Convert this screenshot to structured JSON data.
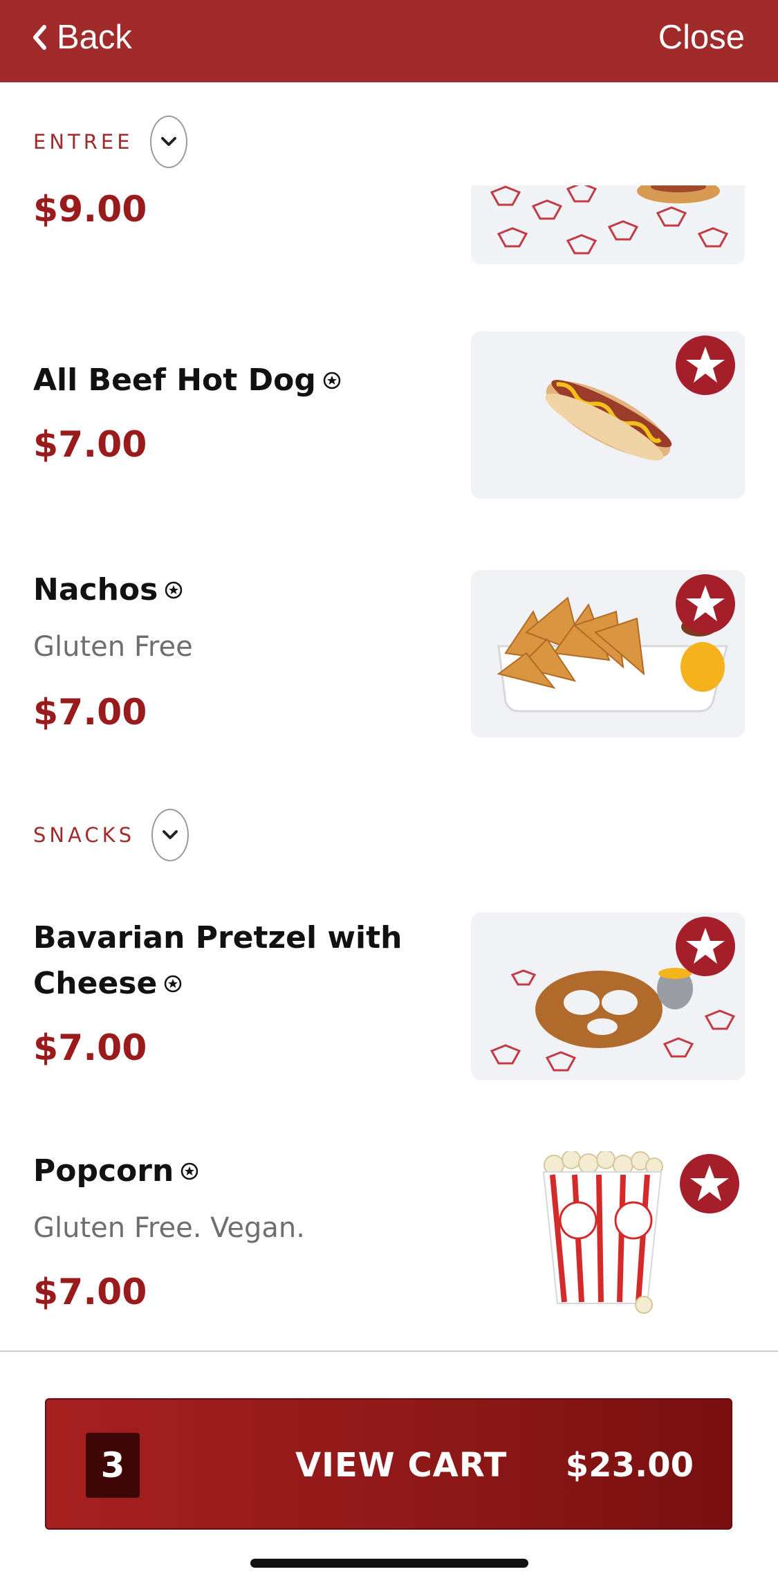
{
  "nav": {
    "back_label": "Back",
    "close_label": "Close"
  },
  "sections": {
    "entree": {
      "label": "ENTREE"
    },
    "snacks": {
      "label": "SNACKS"
    }
  },
  "items": [
    {
      "name": "",
      "description": "",
      "price": "$9.00"
    },
    {
      "name": "All Beef Hot Dog",
      "description": "",
      "price": "$7.00"
    },
    {
      "name": "Nachos",
      "description": "Gluten Free",
      "price": "$7.00"
    },
    {
      "name": "Bavarian Pretzel with Cheese",
      "description": "",
      "price": "$7.00"
    },
    {
      "name": "Popcorn",
      "description": "Gluten Free. Vegan.",
      "price": "$7.00"
    }
  ],
  "cart": {
    "count": "3",
    "label": "VIEW CART",
    "total": "$23.00"
  },
  "colors": {
    "brand": "#a12b2b",
    "price": "#9a1b1b",
    "badge": "#a51f2a"
  },
  "icons": [
    "chevron-left-icon",
    "chevron-down-icon",
    "star-badge-icon",
    "small-star-icon"
  ]
}
